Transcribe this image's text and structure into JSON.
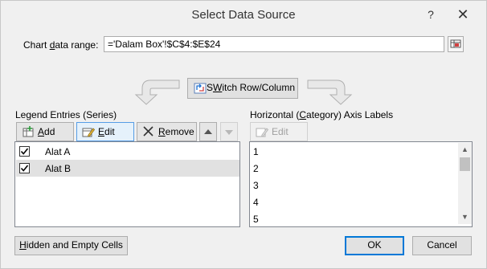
{
  "dialog": {
    "title": "Select Data Source",
    "help_glyph": "?",
    "close_glyph": "✕"
  },
  "chart_range": {
    "label_pre": "Chart ",
    "label_accel": "d",
    "label_post": "ata range:",
    "value": "='Dalam Box'!$C$4:$E$24"
  },
  "switch": {
    "label_accel": "W",
    "label_pre": "S",
    "label_post": "itch Row/Column"
  },
  "legend": {
    "label_pre": "Le",
    "label_accel": "g",
    "label_post": "end Entries (Series)",
    "add_accel": "A",
    "add_rest": "dd",
    "edit_accel": "E",
    "edit_rest": "dit",
    "remove_accel": "R",
    "remove_rest": "emove",
    "series": [
      {
        "name": "Alat A",
        "checked": true
      },
      {
        "name": "Alat B",
        "checked": true
      }
    ]
  },
  "axis": {
    "label_pre": "Horizontal (",
    "label_accel": "C",
    "label_post": "ategory) Axis Labels",
    "edit_label": "Edit",
    "items": [
      "1",
      "2",
      "3",
      "4",
      "5"
    ]
  },
  "footer": {
    "hidden_accel": "H",
    "hidden_rest": "idden and Empty Cells",
    "ok": "OK",
    "cancel": "Cancel"
  },
  "colors": {
    "accent": "#0078d7",
    "dialog_bg": "#f0f0f0"
  }
}
